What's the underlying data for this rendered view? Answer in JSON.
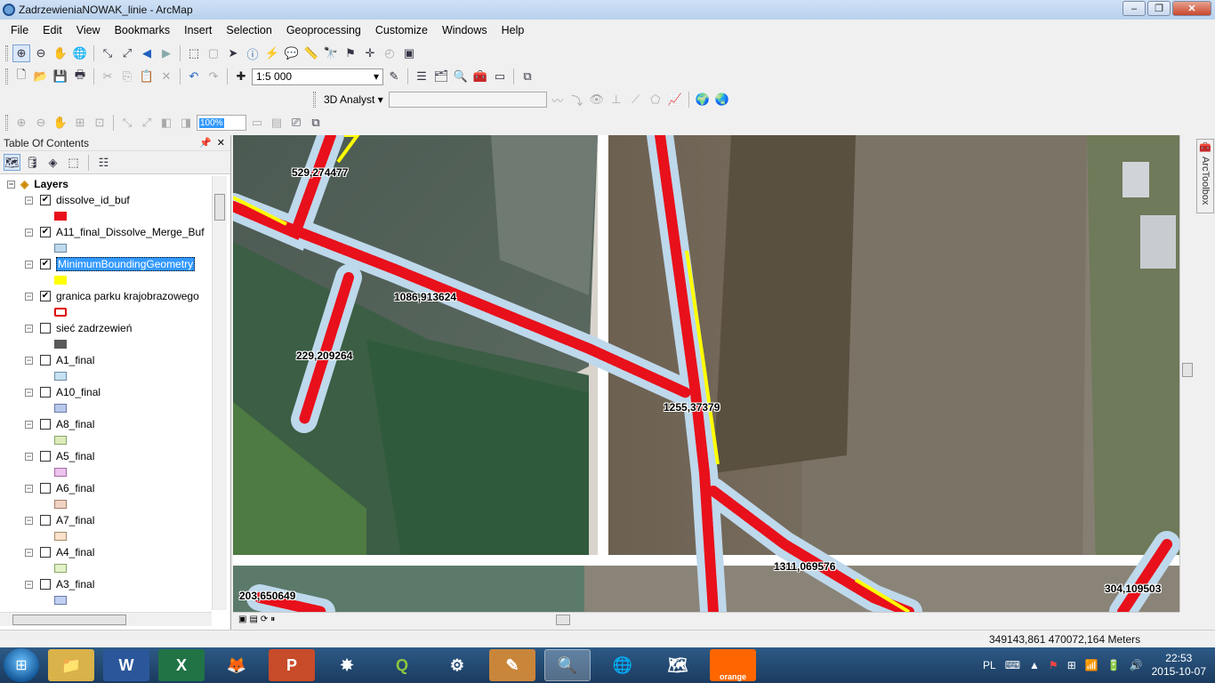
{
  "window": {
    "title": "ZadrzewieniaNOWAK_linie - ArcMap",
    "minimize": "‒",
    "maximize": "❐",
    "close": "✕"
  },
  "menu": [
    "File",
    "Edit",
    "View",
    "Bookmarks",
    "Insert",
    "Selection",
    "Geoprocessing",
    "Customize",
    "Windows",
    "Help"
  ],
  "toolbar": {
    "scale": "1:5 000",
    "analyst_label": "3D Analyst ▾",
    "layout_zoom": "100%"
  },
  "toc": {
    "title": "Table Of Contents",
    "root": "Layers",
    "layers": [
      {
        "name": "dissolve_id_buf",
        "checked": true,
        "swatch_fill": "#e8101a",
        "swatch_border": "#e8101a",
        "selected": false
      },
      {
        "name": "A11_final_Dissolve_Merge_Buf",
        "checked": true,
        "swatch_fill": "#bed8ec",
        "swatch_border": "#6b8aa3",
        "selected": false
      },
      {
        "name": "MinimumBoundingGeometry",
        "checked": true,
        "swatch_fill": "#ffff00",
        "swatch_border": "#ffff00",
        "selected": true
      },
      {
        "name": "granica parku krajobrazowego",
        "checked": true,
        "swatch_fill": "#ffffff",
        "swatch_border": "#e00000",
        "selected": false
      },
      {
        "name": "sieć zadrzewień",
        "checked": false,
        "swatch_fill": "#5a5a5a",
        "swatch_border": "#5a5a5a",
        "selected": false
      },
      {
        "name": "A1_final",
        "checked": false,
        "swatch_fill": "#c6e2f2",
        "swatch_border": "#6b8aa3",
        "selected": false
      },
      {
        "name": "A10_final",
        "checked": false,
        "swatch_fill": "#b8c8ec",
        "swatch_border": "#6b7aa3",
        "selected": false
      },
      {
        "name": "A8_final",
        "checked": false,
        "swatch_fill": "#dcecb8",
        "swatch_border": "#8aa36b",
        "selected": false
      },
      {
        "name": "A5_final",
        "checked": false,
        "swatch_fill": "#ecc2ee",
        "swatch_border": "#a36ba3",
        "selected": false
      },
      {
        "name": "A6_final",
        "checked": false,
        "swatch_fill": "#f0d2c2",
        "swatch_border": "#a37f6b",
        "selected": false
      },
      {
        "name": "A7_final",
        "checked": false,
        "swatch_fill": "#fae2cc",
        "swatch_border": "#a38a6b",
        "selected": false
      },
      {
        "name": "A4_final",
        "checked": false,
        "swatch_fill": "#e2f2c6",
        "swatch_border": "#8aa36b",
        "selected": false
      },
      {
        "name": "A3_final",
        "checked": false,
        "swatch_fill": "#c0cef2",
        "swatch_border": "#6b7aa3",
        "selected": false
      }
    ]
  },
  "map_labels": [
    "529,274477",
    "1086,913624",
    "229,209264",
    "1255,37379",
    "1311,069576",
    "203,650649",
    "304,109503"
  ],
  "arctoolbox": "ArcToolbox",
  "status": {
    "coordinates": "349143,861  470072,164 Meters"
  },
  "taskbar": {
    "apps": [
      "Explorer",
      "Word",
      "Excel",
      "Firefox",
      "PowerPoint",
      "Flash",
      "QGIS",
      "Tool",
      "Notes",
      "ArcMap",
      "Google Earth",
      "Map",
      "orange"
    ],
    "language": "PL",
    "time": "22:53",
    "date": "2015-10-07"
  },
  "colors": {
    "titlebar": "#c8dcf2",
    "selection": "#3399ff",
    "buffer": "#bed8ec",
    "trees": "#e8101a",
    "boundary": "#ffff00"
  }
}
